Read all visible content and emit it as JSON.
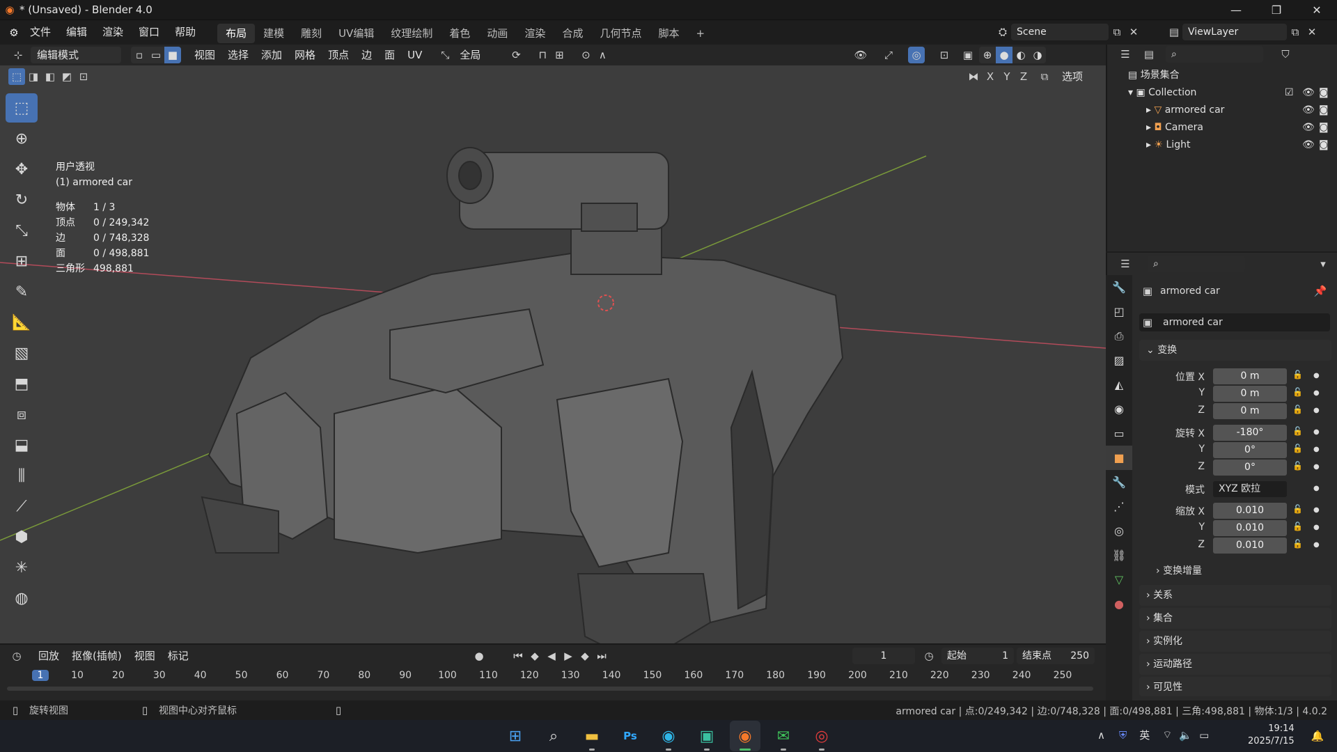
{
  "window": {
    "title": "* (Unsaved) - Blender 4.0"
  },
  "menus": [
    "文件",
    "编辑",
    "渲染",
    "窗口",
    "帮助"
  ],
  "workspaces": [
    "布局",
    "建模",
    "雕刻",
    "UV编辑",
    "纹理绘制",
    "着色",
    "动画",
    "渲染",
    "合成",
    "几何节点",
    "脚本"
  ],
  "active_workspace": "布局",
  "add_tab": "+",
  "scene": "Scene",
  "view_layer": "ViewLayer",
  "viewport_header": {
    "mode": "编辑模式",
    "menus": [
      "视图",
      "选择",
      "添加",
      "网格",
      "顶点",
      "边",
      "面",
      "UV"
    ],
    "transform": "全局",
    "options": "选项",
    "axes": [
      "X",
      "Y",
      "Z"
    ]
  },
  "overlay": {
    "view_name": "用户透视",
    "object_name": "(1) armored car",
    "stats": [
      {
        "k": "物体",
        "v": "1 / 3"
      },
      {
        "k": "顶点",
        "v": "0 / 249,342"
      },
      {
        "k": "边",
        "v": "0 / 748,328"
      },
      {
        "k": "面",
        "v": "0 / 498,881"
      },
      {
        "k": "三角形",
        "v": "498,881"
      }
    ]
  },
  "outliner": {
    "root": "场景集合",
    "collection": "Collection",
    "items": [
      "armored car",
      "Camera",
      "Light"
    ]
  },
  "properties": {
    "object_name": "armored car",
    "data_name": "armored car",
    "transform_header": "变换",
    "location": {
      "label": "位置 X",
      "x": "0 m",
      "y": "0 m",
      "z": "0 m"
    },
    "rotation": {
      "label": "旋转 X",
      "x": "-180°",
      "y": "0°",
      "z": "0°"
    },
    "mode": {
      "label": "模式",
      "value": "XYZ 欧拉"
    },
    "scale": {
      "label": "缩放 X",
      "x": "0.010",
      "y": "0.010",
      "z": "0.010"
    },
    "axis_y": "Y",
    "axis_z": "Z",
    "delta": "变换增量",
    "sections": [
      "关系",
      "集合",
      "实例化",
      "运动路径",
      "可见性"
    ]
  },
  "timeline": {
    "menus": [
      "回放",
      "抠像(插帧)",
      "视图",
      "标记"
    ],
    "current_frame": "1",
    "start_label": "起始",
    "start": "1",
    "end_label": "结束点",
    "end": "250",
    "ticks": [
      "1",
      "10",
      "20",
      "30",
      "40",
      "50",
      "60",
      "70",
      "80",
      "90",
      "100",
      "110",
      "120",
      "130",
      "140",
      "150",
      "160",
      "170",
      "180",
      "190",
      "200",
      "210",
      "220",
      "230",
      "240",
      "250"
    ]
  },
  "status": {
    "left1": "旋转视图",
    "left2": "视图中心对齐鼠标",
    "right": "armored car | 点:0/249,342 | 边:0/748,328 | 面:0/498,881 | 三角:498,881 | 物体:1/3 | 4.0.2"
  },
  "taskbar": {
    "lang": "英",
    "time": "19:14",
    "date": "2025/7/15"
  },
  "colors": {
    "accent": "#4772b3",
    "x_axis": "#b34b5a",
    "y_axis": "#7a9a3a"
  }
}
